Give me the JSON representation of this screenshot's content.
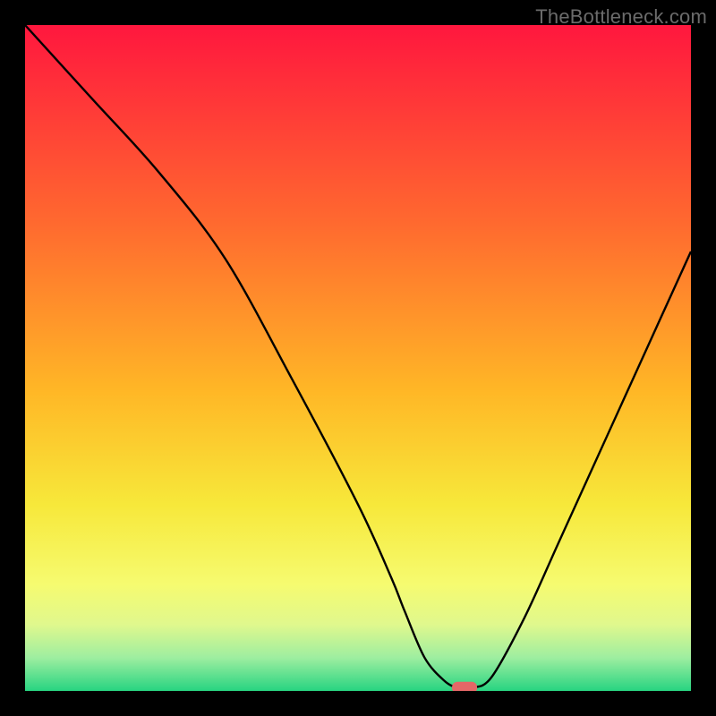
{
  "watermark": "TheBottleneck.com",
  "chart_data": {
    "type": "line",
    "title": "",
    "xlabel": "",
    "ylabel": "",
    "xlim": [
      0,
      100
    ],
    "ylim": [
      0,
      100
    ],
    "x": [
      0,
      10,
      20,
      30,
      40,
      50,
      55,
      57,
      60,
      63,
      65,
      67,
      70,
      75,
      80,
      85,
      90,
      95,
      100
    ],
    "values": [
      100,
      89,
      78,
      65,
      47,
      28,
      17,
      12,
      5,
      1.5,
      0.5,
      0.5,
      2,
      11,
      22,
      33,
      44,
      55,
      66
    ],
    "marker": {
      "x": 66,
      "y": 0.5
    },
    "gradient_stops": [
      {
        "offset": 0,
        "color": "#ff173e"
      },
      {
        "offset": 0.3,
        "color": "#ff6a2f"
      },
      {
        "offset": 0.55,
        "color": "#ffb726"
      },
      {
        "offset": 0.72,
        "color": "#f7e83a"
      },
      {
        "offset": 0.84,
        "color": "#f6fb70"
      },
      {
        "offset": 0.9,
        "color": "#e0f88d"
      },
      {
        "offset": 0.95,
        "color": "#9eeea0"
      },
      {
        "offset": 1.0,
        "color": "#27d481"
      }
    ],
    "line_color": "#000000",
    "marker_color": "#e56767",
    "grid": false,
    "legend": false
  }
}
